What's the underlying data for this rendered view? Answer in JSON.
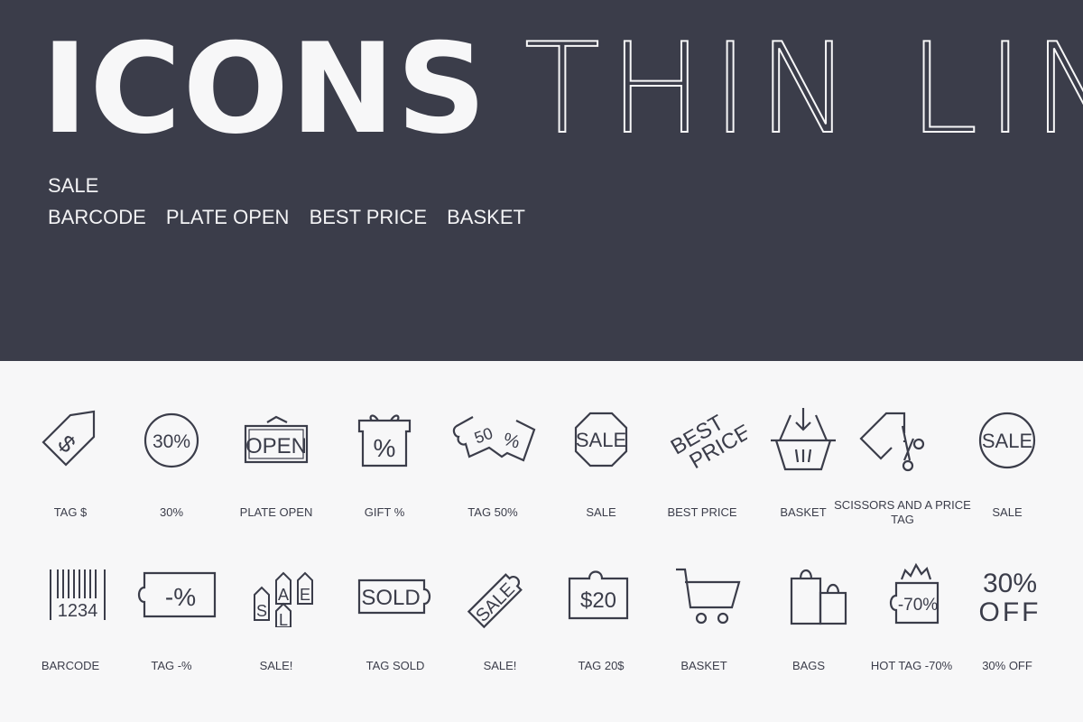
{
  "hero": {
    "title_bold": "ICONS",
    "title_thin": "THIN LINE",
    "line1": [
      "SALE"
    ],
    "line2": [
      "BARCODE",
      "PLATE OPEN",
      "BEST PRICE",
      "BASKET"
    ]
  },
  "colors": {
    "hero_bg": "#3b3d4a",
    "page_bg": "#f7f7f8",
    "icon_stroke": "#3b3d4a"
  },
  "icons": {
    "row1": [
      {
        "label": "TAG $",
        "icon": "tag-dollar-icon"
      },
      {
        "label": "30%",
        "icon": "circle-30-percent-icon",
        "text": "30%"
      },
      {
        "label": "PLATE OPEN",
        "icon": "open-sign-icon",
        "text": "OPEN"
      },
      {
        "label": "GIFT %",
        "icon": "gift-percent-icon",
        "text": "%"
      },
      {
        "label": "TAG 50%",
        "icon": "tag-50-percent-icon",
        "text": "50 %"
      },
      {
        "label": "SALE",
        "icon": "octagon-sale-icon",
        "text": "SALE"
      },
      {
        "label": "BEST PRICE",
        "icon": "best-price-icon",
        "text": "BEST PRICE"
      },
      {
        "label": "BASKET",
        "icon": "basket-download-icon"
      },
      {
        "label": "SCISSORS AND A PRICE TAG",
        "icon": "scissors-tag-icon"
      },
      {
        "label": "SALE",
        "icon": "circle-sale-icon",
        "text": "SALE"
      }
    ],
    "row2": [
      {
        "label": "BARCODE",
        "icon": "barcode-icon",
        "text": "1234"
      },
      {
        "label": "TAG -%",
        "icon": "tag-minus-percent-icon",
        "text": "-%"
      },
      {
        "label": "SALE!",
        "icon": "sale-tags-icon",
        "text": "SALE"
      },
      {
        "label": "TAG SOLD",
        "icon": "tag-sold-icon",
        "text": "SOLD"
      },
      {
        "label": "SALE!",
        "icon": "sale-tag-rotated-icon",
        "text": "SALE"
      },
      {
        "label": "TAG 20$",
        "icon": "tag-20-dollar-icon",
        "text": "$20"
      },
      {
        "label": "BASKET",
        "icon": "shopping-cart-icon"
      },
      {
        "label": "BAGS",
        "icon": "shopping-bags-icon"
      },
      {
        "label": "HOT TAG -70%",
        "icon": "hot-tag-icon",
        "text": "-70%"
      },
      {
        "label": "30% OFF",
        "icon": "30-off-icon",
        "text": "30% OFF"
      }
    ]
  }
}
